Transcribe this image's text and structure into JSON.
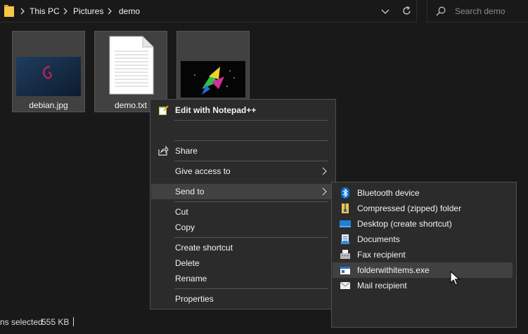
{
  "address": {
    "crumbs": [
      "This PC",
      "Pictures",
      "demo"
    ],
    "folder_icon": "folder-icon",
    "dropdown_icon": "chevron-down-icon",
    "refresh_icon": "refresh-icon"
  },
  "search": {
    "placeholder": "Search demo",
    "icon": "search-icon"
  },
  "files": [
    {
      "name": "debian.jpg",
      "thumb": "debian-logo-thumbnail"
    },
    {
      "name": "demo.txt",
      "thumb": "text-document-thumbnail"
    },
    {
      "name": "",
      "thumb": "colorful-bird-thumbnail"
    }
  ],
  "status": {
    "text": "ns selected",
    "size": "555 KB"
  },
  "context_menu": {
    "items": [
      {
        "label": "Edit with Notepad++",
        "icon": "notepadpp-icon"
      },
      {
        "label": "Share",
        "icon": "share-icon"
      },
      {
        "label": "Give access to",
        "submenu": true
      },
      {
        "label": "Send to",
        "submenu": true,
        "highlighted": true
      },
      {
        "label": "Cut"
      },
      {
        "label": "Copy"
      },
      {
        "label": "Create shortcut"
      },
      {
        "label": "Delete"
      },
      {
        "label": "Rename"
      },
      {
        "label": "Properties"
      }
    ]
  },
  "send_to_menu": {
    "items": [
      {
        "label": "Bluetooth device",
        "icon": "bluetooth-icon"
      },
      {
        "label": "Compressed (zipped) folder",
        "icon": "zip-folder-icon"
      },
      {
        "label": "Desktop (create shortcut)",
        "icon": "desktop-icon"
      },
      {
        "label": "Documents",
        "icon": "documents-icon"
      },
      {
        "label": "Fax recipient",
        "icon": "fax-icon"
      },
      {
        "label": "folderwithitems.exe",
        "icon": "exe-icon",
        "highlighted": true
      },
      {
        "label": "Mail recipient",
        "icon": "mail-icon"
      }
    ]
  },
  "colors": {
    "background": "#191919",
    "menu_bg": "#2b2b2b",
    "menu_highlight": "#414141",
    "selection_tile": "#414141",
    "bluetooth_blue": "#0a6fd6",
    "folder_yellow": "#f6c944"
  }
}
